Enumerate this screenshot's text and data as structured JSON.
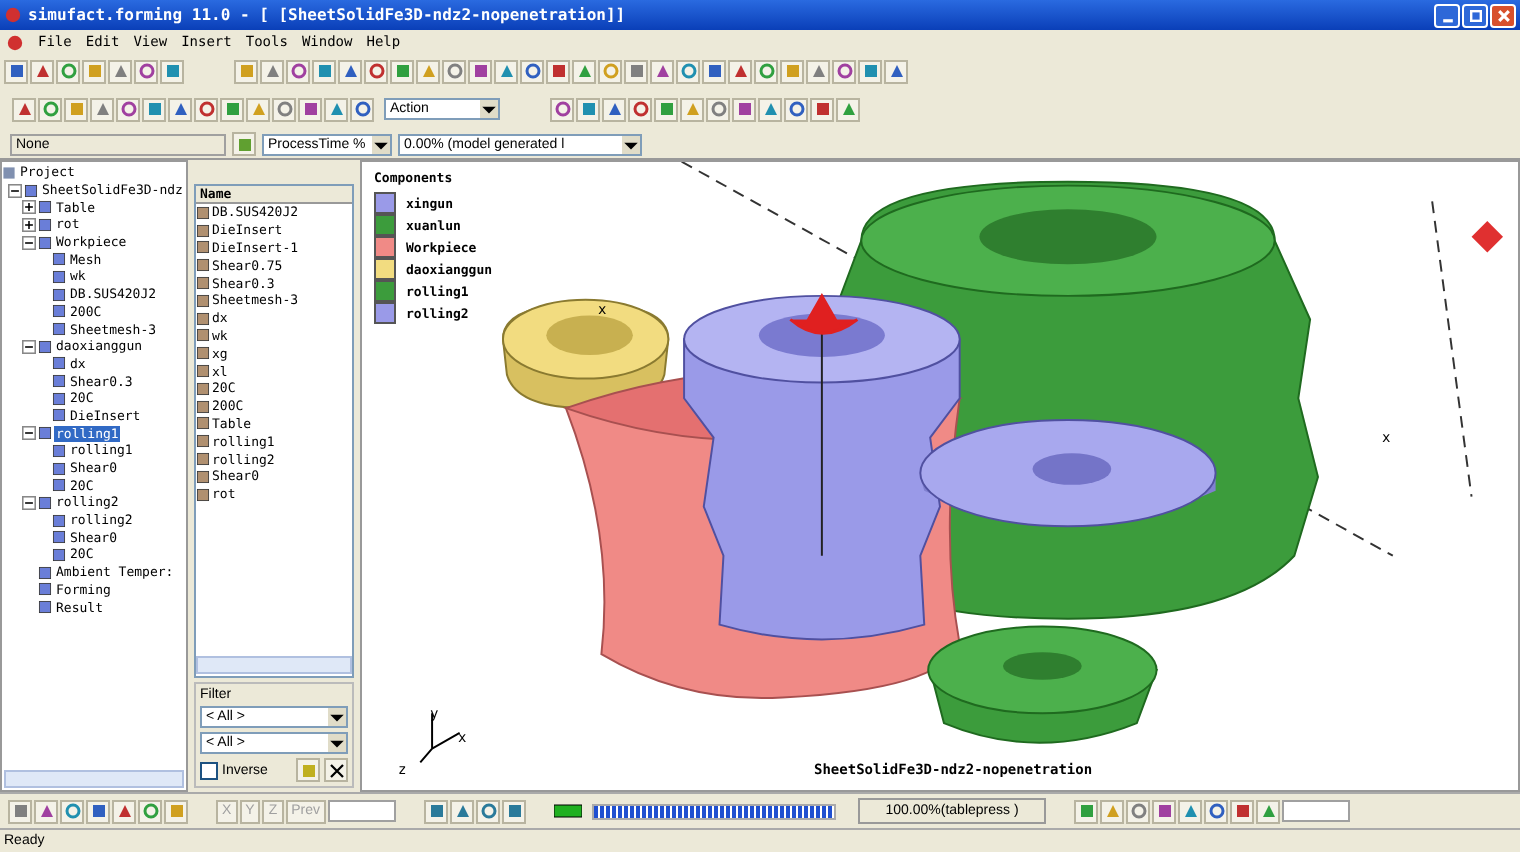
{
  "window": {
    "title": "simufact.forming 11.0 - [ [SheetSolidFe3D-ndz2-nopenetration]]"
  },
  "menu": [
    "File",
    "Edit",
    "View",
    "Insert",
    "Tools",
    "Window",
    "Help"
  ],
  "toolbar": {
    "action_dropdown": "Action"
  },
  "fields": {
    "selection": "None",
    "result_type": "ProcessTime %",
    "result_step": "0.00% (model generated l"
  },
  "tree": {
    "label": "Project",
    "children": [
      {
        "label": "SheetSolidFe3D-ndz",
        "selected": false,
        "expanded": true,
        "children": [
          {
            "label": "Table",
            "selected": false,
            "expanded": false
          },
          {
            "label": "rot",
            "selected": false,
            "expanded": false
          },
          {
            "label": "Workpiece",
            "selected": false,
            "expanded": true,
            "children": [
              {
                "label": "Mesh",
                "selected": false
              },
              {
                "label": "wk",
                "selected": false
              },
              {
                "label": "DB.SUS420J2",
                "selected": false
              },
              {
                "label": "200C",
                "selected": false
              },
              {
                "label": "Sheetmesh-3",
                "selected": false
              }
            ]
          },
          {
            "label": "daoxianggun",
            "selected": false,
            "expanded": true,
            "children": [
              {
                "label": "dx",
                "selected": false
              },
              {
                "label": "Shear0.3",
                "selected": false
              },
              {
                "label": "20C",
                "selected": false
              },
              {
                "label": "DieInsert",
                "selected": false
              }
            ]
          },
          {
            "label": "rolling1",
            "selected": true,
            "expanded": true,
            "children": [
              {
                "label": "rolling1",
                "selected": false
              },
              {
                "label": "Shear0",
                "selected": false
              },
              {
                "label": "20C",
                "selected": false
              }
            ]
          },
          {
            "label": "rolling2",
            "selected": false,
            "expanded": true,
            "children": [
              {
                "label": "rolling2",
                "selected": false
              },
              {
                "label": "Shear0",
                "selected": false
              },
              {
                "label": "20C",
                "selected": false
              }
            ]
          },
          {
            "label": "Ambient Temper:",
            "selected": false
          },
          {
            "label": "Forming",
            "selected": false
          },
          {
            "label": "Result",
            "selected": false
          }
        ]
      }
    ]
  },
  "list": {
    "header": "Name",
    "items": [
      "DB.SUS420J2",
      "DieInsert",
      "DieInsert-1",
      "Shear0.75",
      "Shear0.3",
      "Sheetmesh-3",
      "dx",
      "wk",
      "xg",
      "xl",
      "20C",
      "200C",
      "Table",
      "rolling1",
      "rolling2",
      "Shear0",
      "rot"
    ]
  },
  "filter": {
    "title": "Filter",
    "dropdowns": [
      "< All >",
      "< All >"
    ],
    "inverse": {
      "label": "Inverse",
      "checked": false
    }
  },
  "viewport": {
    "legend_title": "Components",
    "legend": [
      {
        "name": "xingun",
        "color": "#9a9ae8"
      },
      {
        "name": "xuanlun",
        "color": "#3c9c3c"
      },
      {
        "name": "Workpiece",
        "color": "#f08a86"
      },
      {
        "name": "daoxianggun",
        "color": "#f2dc80"
      },
      {
        "name": "rolling1",
        "color": "#3c9c3c"
      },
      {
        "name": "rolling2",
        "color": "#9a9ae8"
      }
    ],
    "axis_marks": [
      "x",
      "x"
    ],
    "triad": [
      "y",
      "x",
      "z"
    ],
    "caption": "SheetSolidFe3D-ndz2-nopenetration"
  },
  "bottom_toolbar": {
    "coords": [
      {
        "label": "X",
        "disabled": true
      },
      {
        "label": "Y",
        "disabled": true
      },
      {
        "label": "Z",
        "disabled": true
      },
      {
        "label": "Prev",
        "disabled": true
      }
    ],
    "progress": {
      "level": 1.0
    },
    "progress_text": "100.00%(tablepress )"
  },
  "status_bar": "Ready"
}
